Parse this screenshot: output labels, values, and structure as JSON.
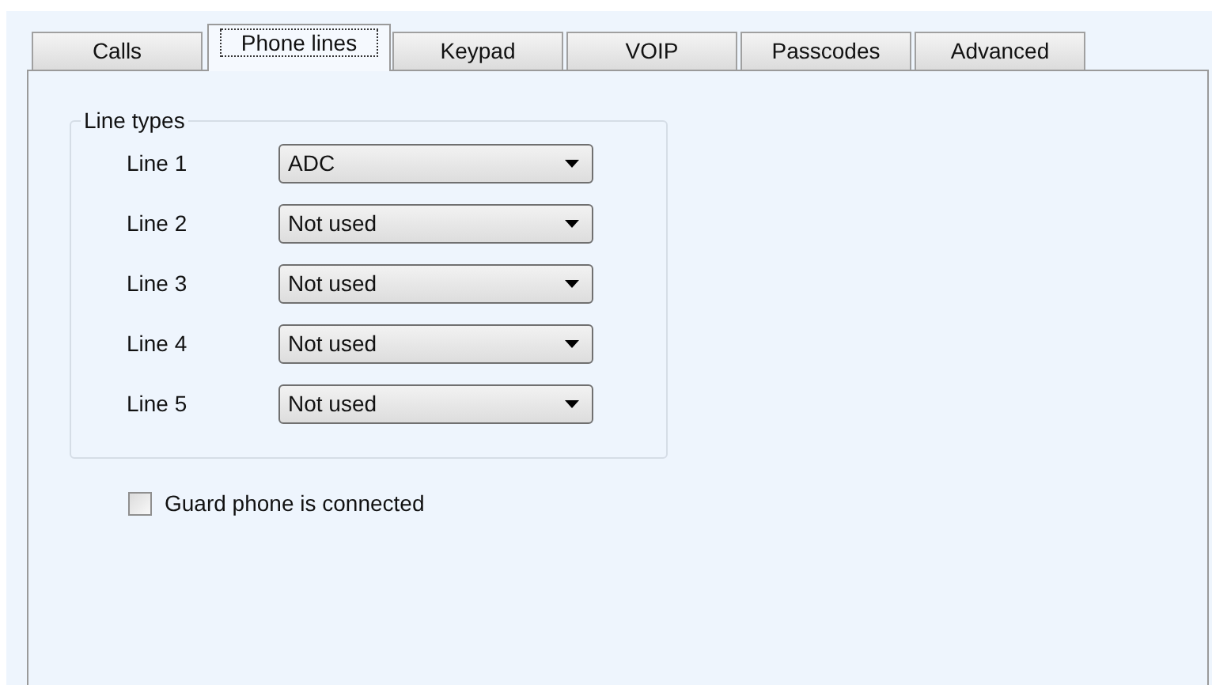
{
  "tabs": [
    {
      "label": "Calls",
      "selected": false
    },
    {
      "label": "Phone lines",
      "selected": true
    },
    {
      "label": "Keypad",
      "selected": false
    },
    {
      "label": "VOIP",
      "selected": false
    },
    {
      "label": "Passcodes",
      "selected": false
    },
    {
      "label": "Advanced",
      "selected": false
    }
  ],
  "line_types": {
    "title": "Line types",
    "lines": [
      {
        "label": "Line 1",
        "value": "ADC"
      },
      {
        "label": "Line 2",
        "value": "Not used"
      },
      {
        "label": "Line 3",
        "value": "Not used"
      },
      {
        "label": "Line 4",
        "value": "Not used"
      },
      {
        "label": "Line 5",
        "value": "Not used"
      }
    ]
  },
  "guard_phone": {
    "label": "Guard phone is connected",
    "checked": false
  }
}
